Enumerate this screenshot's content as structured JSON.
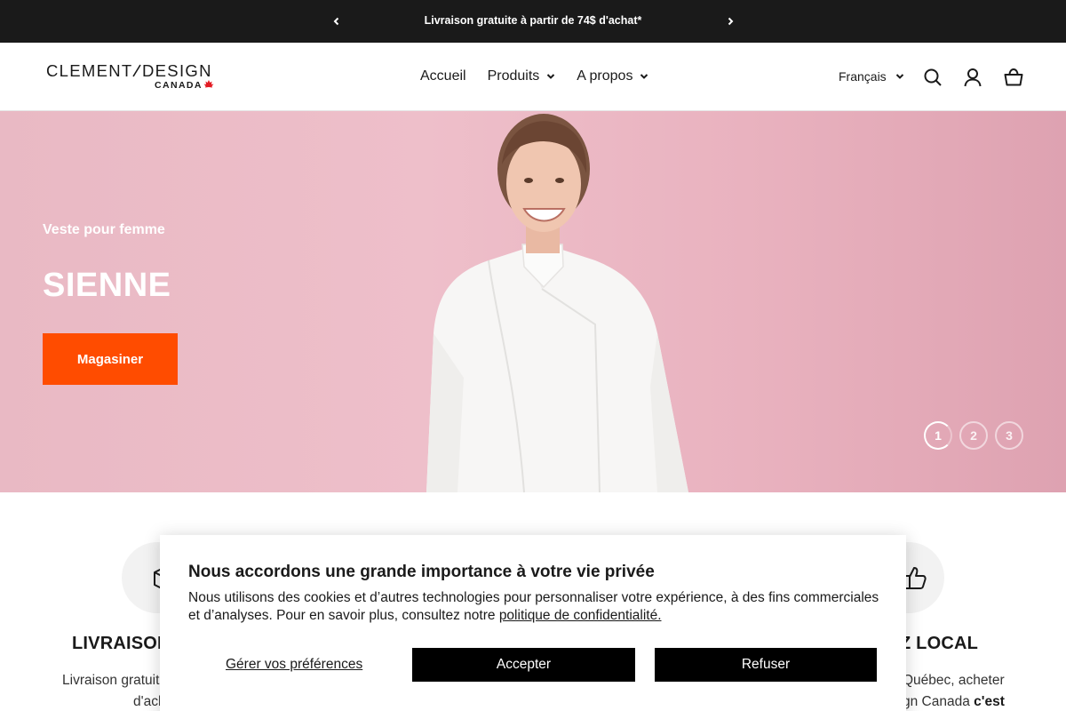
{
  "announcement": {
    "message": "Livraison gratuite à partir de 74$ d'achat*"
  },
  "header": {
    "logo": {
      "name": "CLEMENT DESIGN",
      "sub": "CANADA"
    },
    "nav": [
      {
        "label": "Accueil"
      },
      {
        "label": "Produits"
      },
      {
        "label": "A propos"
      }
    ],
    "language": "Français"
  },
  "hero": {
    "eyebrow": "Veste pour femme",
    "title": "SIENNE",
    "cta": "Magasiner",
    "slides": [
      "1",
      "2",
      "3"
    ],
    "active_slide": 1
  },
  "features": {
    "left": {
      "title": "LIVRAISON",
      "text": "Livraison gratuite",
      "text2": "d'ach"
    },
    "right": {
      "title": "Z LOCAL",
      "text": "Québec, acheter",
      "text2": "gn Canada",
      "text2_bold": "c'est"
    }
  },
  "cookie": {
    "title": "Nous accordons une grande importance à votre vie privée",
    "body": "Nous utilisons des cookies et d’autres technologies pour personnaliser votre expérience, à des fins commerciales et d’analyses. Pour en savoir plus, consultez notre ",
    "link": "politique de confidentialité.",
    "prefs": "Gérer vos préférences",
    "accept": "Accepter",
    "refuse": "Refuser"
  },
  "colors": {
    "accent": "#ff4c00",
    "announce_bg": "#1a1a1a",
    "hero_bg": "#ebb9c5"
  }
}
